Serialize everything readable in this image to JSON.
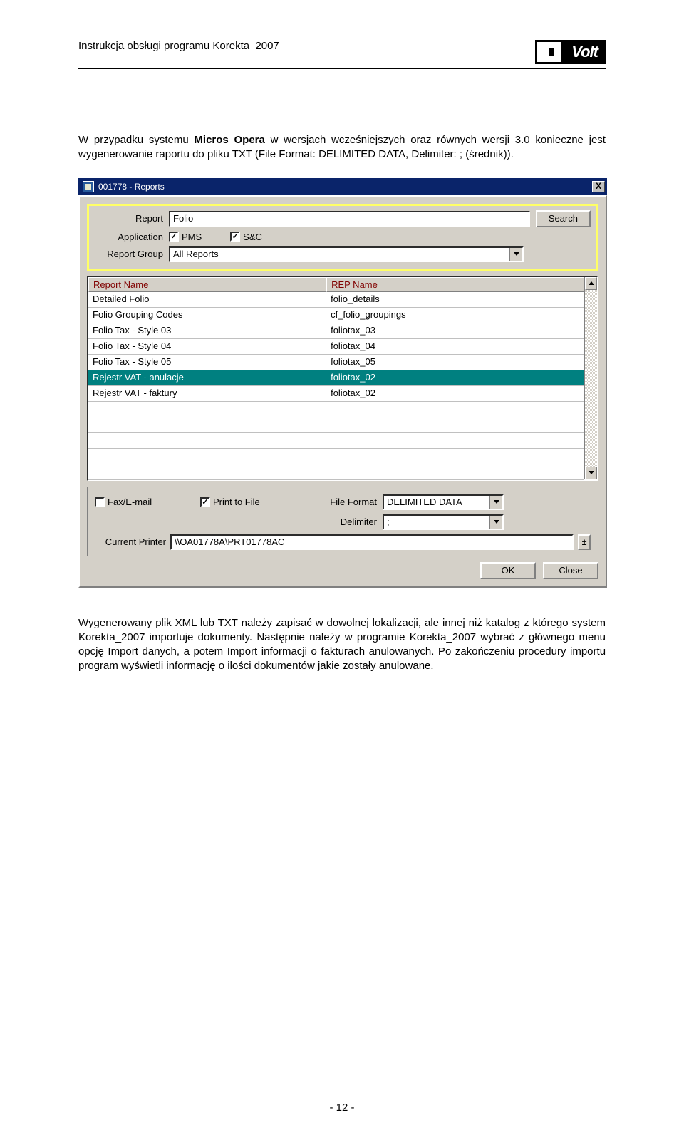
{
  "doc": {
    "header_title": "Instrukcja obsługi programu Korekta_2007",
    "logo_text": "Volt"
  },
  "para1_parts": {
    "a": "W przypadku systemu ",
    "b": "Micros Opera",
    "c": " w wersjach wcześniejszych oraz równych wersji 3.0 konieczne jest wygenerowanie raportu do pliku TXT (File Format: DELIMITED DATA, Delimiter: ; (średnik))."
  },
  "shot": {
    "window_title": "001778 - Reports",
    "close_glyph": "X",
    "labels": {
      "report": "Report",
      "application": "Application",
      "report_group": "Report Group",
      "fax": "Fax/E-mail",
      "print_to_file": "Print to File",
      "file_format": "File Format",
      "delimiter": "Delimiter",
      "current_printer": "Current Printer"
    },
    "values": {
      "report": "Folio",
      "report_group": "All Reports",
      "file_format": "DELIMITED DATA",
      "delimiter": ";",
      "current_printer": "\\\\OA01778A\\PRT01778AC"
    },
    "checks": {
      "pms": "PMS",
      "sc": "S&C"
    },
    "buttons": {
      "search": "Search",
      "ok": "OK",
      "close": "Close"
    },
    "grid": {
      "cols": [
        "Report Name",
        "REP Name"
      ],
      "rows": [
        {
          "name": "Detailed Folio",
          "rep": "folio_details",
          "sel": false
        },
        {
          "name": "Folio Grouping Codes",
          "rep": "cf_folio_groupings",
          "sel": false
        },
        {
          "name": "Folio Tax - Style 03",
          "rep": "foliotax_03",
          "sel": false
        },
        {
          "name": "Folio Tax - Style 04",
          "rep": "foliotax_04",
          "sel": false
        },
        {
          "name": "Folio Tax - Style 05",
          "rep": "foliotax_05",
          "sel": false
        },
        {
          "name": "Rejestr VAT - anulacje",
          "rep": "foliotax_02",
          "sel": true
        },
        {
          "name": "Rejestr VAT - faktury",
          "rep": "foliotax_02",
          "sel": false
        }
      ]
    }
  },
  "para2_parts": {
    "a": "Wygenerowany plik XML lub TXT należy zapisać w dowolnej lokalizacji, ale innej niż katalog z którego system ",
    "b": "Korekta_2007",
    "c": " importuje dokumenty. Następnie należy w programie ",
    "d": "Korekta_2007",
    "e": " wybrać z głównego menu opcję ",
    "f": "Import danych",
    "g": ", a potem ",
    "h": "Import informacji o fakturach anulowanych",
    "i": ". Po zakończeniu procedury importu program wyświetli informację o ilości dokumentów jakie zostały anulowane."
  },
  "page_number": "- 12 -"
}
